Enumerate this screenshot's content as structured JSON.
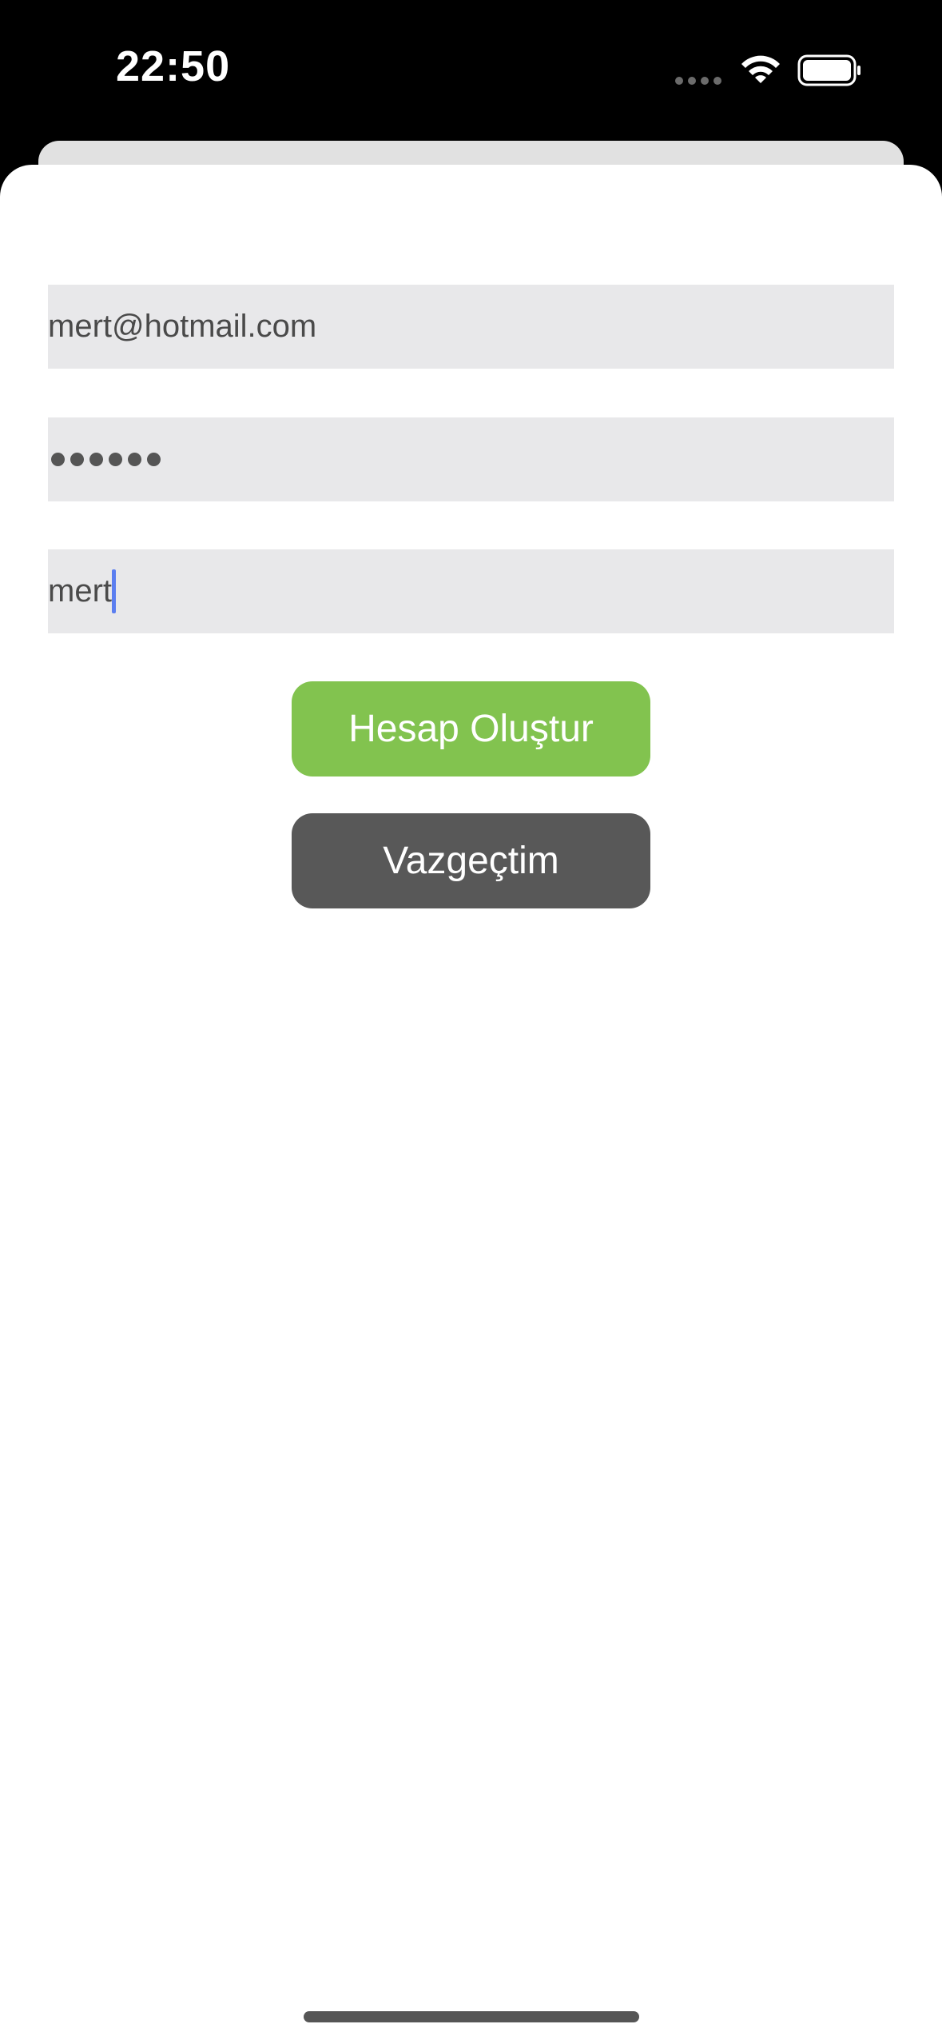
{
  "status_bar": {
    "time": "22:50",
    "icons": [
      "signal-dots-icon",
      "wifi-icon",
      "battery-icon"
    ]
  },
  "form": {
    "email_value": "mert@hotmail.com",
    "password_length": 6,
    "name_value": "mert"
  },
  "buttons": {
    "create_label": "Hesap Oluştur",
    "cancel_label": "Vazgeçtim"
  },
  "colors": {
    "create_button": "#82c34f",
    "cancel_button": "#585858",
    "field_background": "#e8e8ea",
    "caret": "#5b7ef0"
  }
}
